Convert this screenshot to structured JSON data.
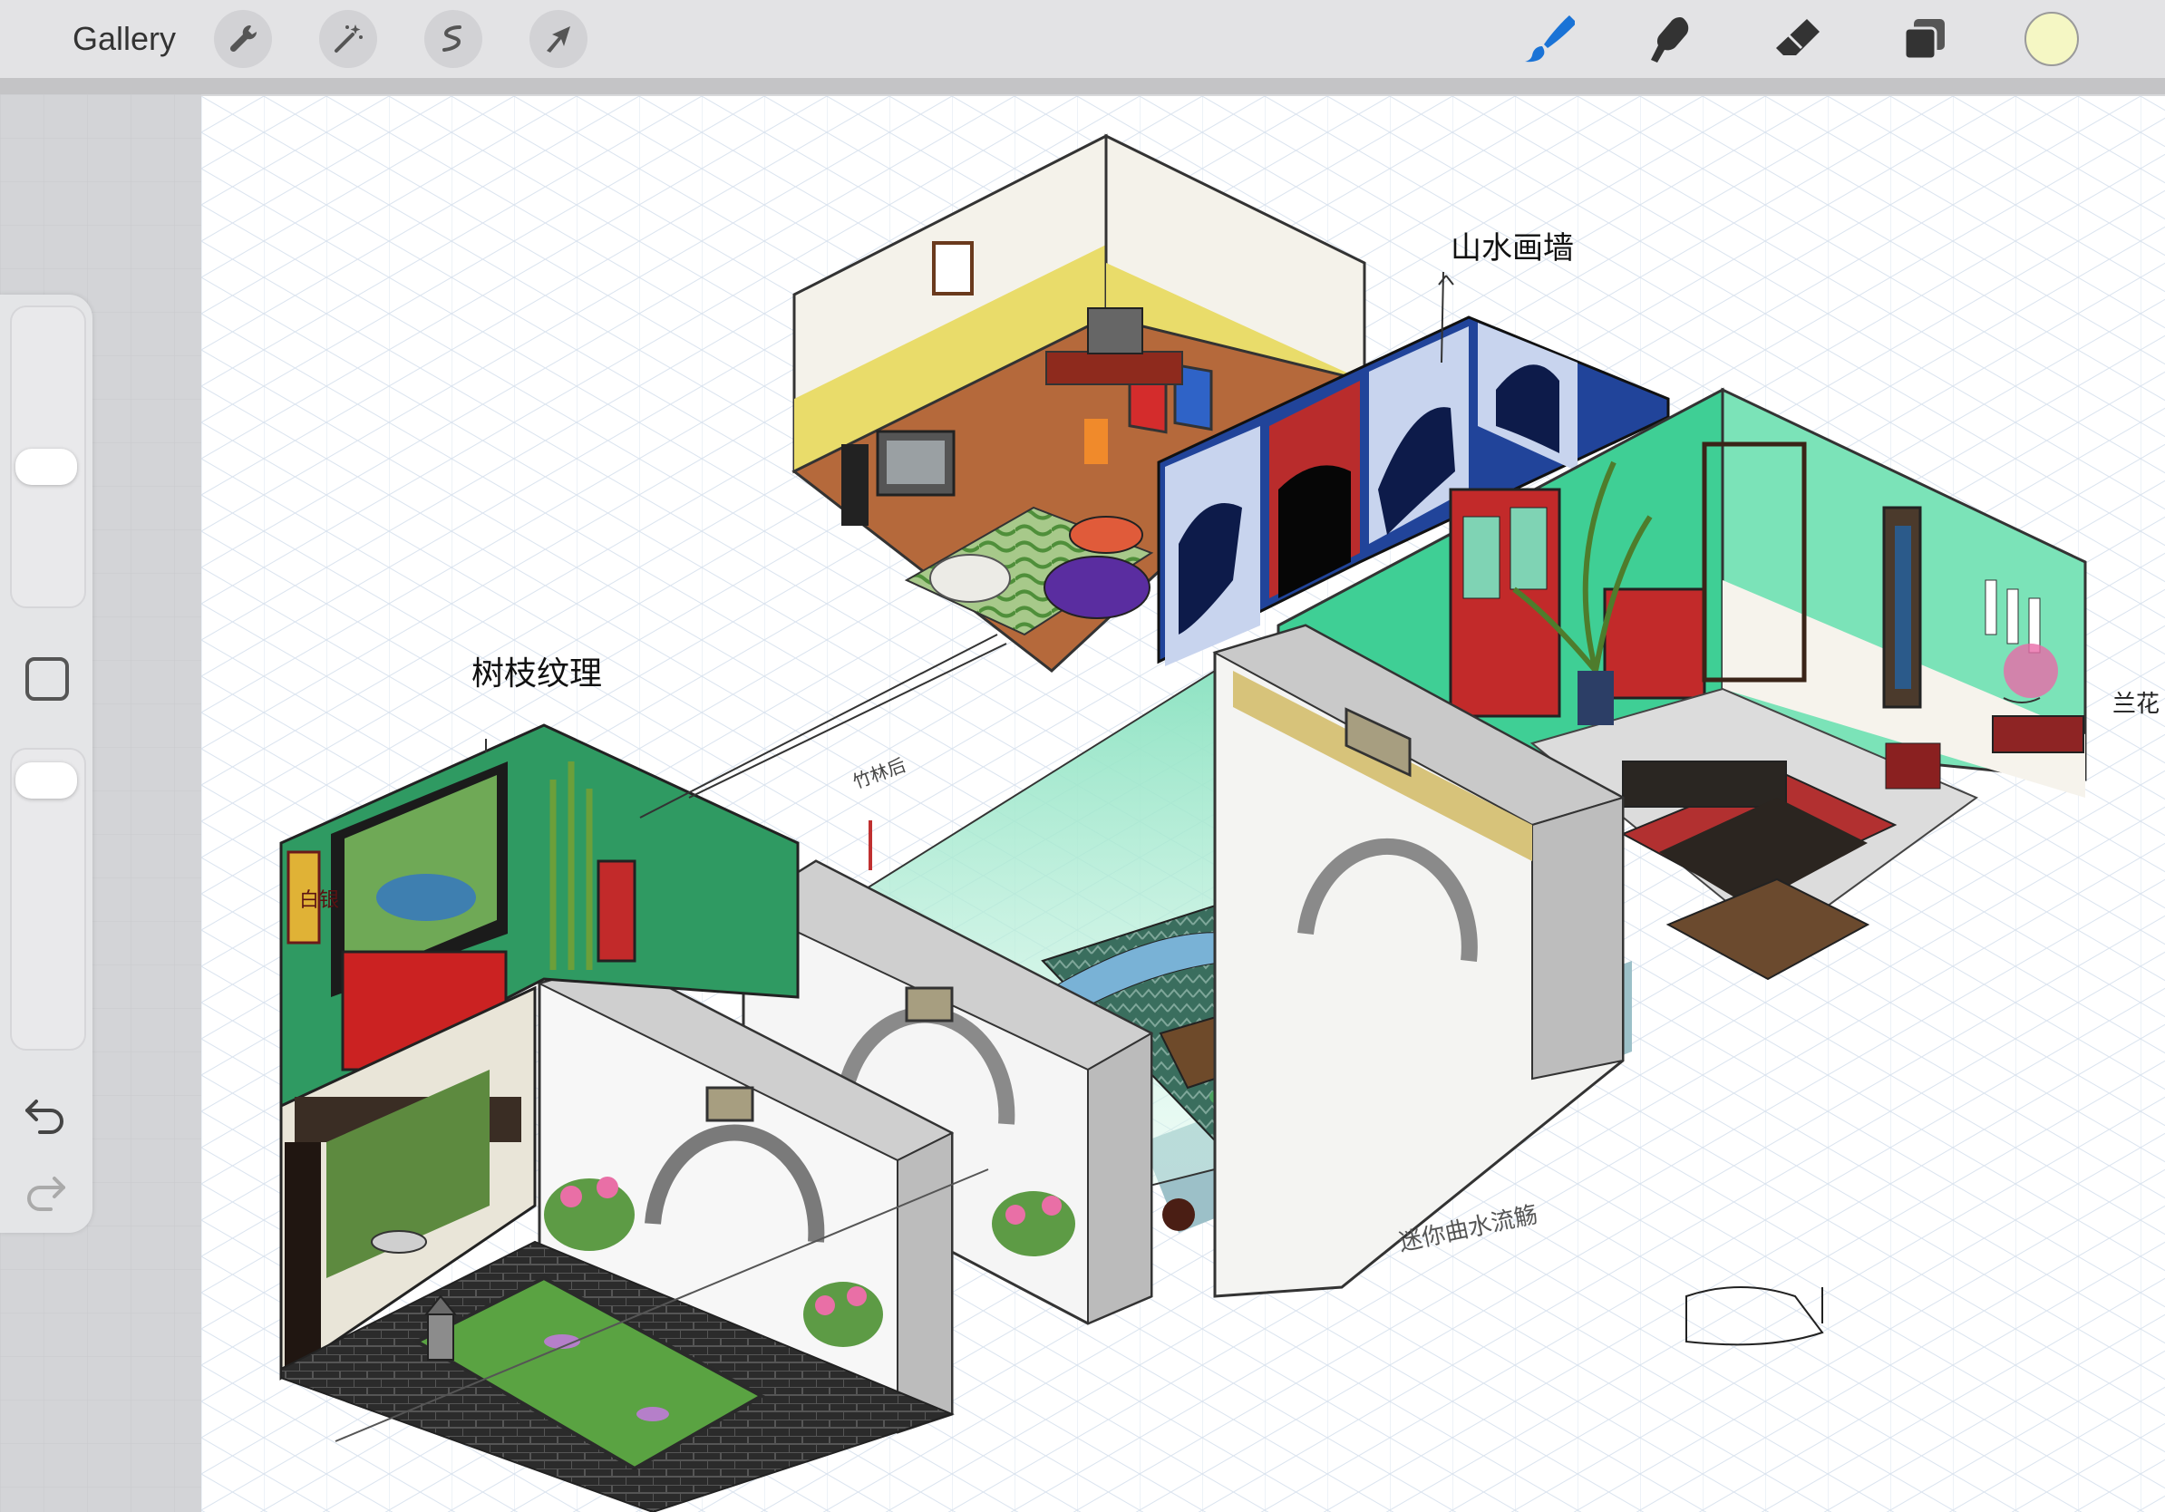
{
  "toolbar": {
    "gallery_label": "Gallery",
    "left_tools": [
      "wrench-icon",
      "magic-wand-icon",
      "selection-icon",
      "transform-arrow-icon"
    ],
    "right_tools": [
      "brush-icon",
      "smudge-icon",
      "eraser-icon",
      "layers-icon",
      "color-swatch"
    ],
    "brush_color": "#1a73d6",
    "current_color": "#f5f7c4"
  },
  "sidebar": {
    "tools": [
      "brush-size-slider",
      "modify-button",
      "opacity-slider",
      "undo-icon",
      "redo-icon"
    ]
  },
  "canvas": {
    "annotations": {
      "texture": "树枝纹理",
      "calligraphy": "山水画墙",
      "orchid": "兰花",
      "stream": "迷你曲水流觞",
      "scroll": "白银",
      "note": "竹林后"
    }
  }
}
